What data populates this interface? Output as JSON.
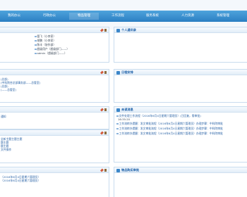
{
  "nav": {
    "items": [
      {
        "label": "我的办公"
      },
      {
        "label": "行政办公"
      },
      {
        "label": "物品管理"
      },
      {
        "label": "工作流程"
      },
      {
        "label": "服务系统"
      },
      {
        "label": "人力资源"
      },
      {
        "label": "系统管理"
      }
    ]
  },
  "left_panels": [
    {
      "title": "",
      "rows": [
        "管飞（小李家）",
        "胡鹏（小李家）",
        "陈丰（协作部）",
        "超级用户（超级部门——）",
        "admin（超级部门——）"
      ]
    },
    {
      "title": "",
      "rows": [
        "(总部)",
        "(中科院合总部事务部——总管室)",
        "(总部)",
        "(——总管室)"
      ]
    },
    {
      "title": "",
      "rows": [
        "通知"
      ]
    },
    {
      "title": "",
      "rows": [
        "全新主题主题主题",
        "题主题",
        "题主题",
        "文件操作"
      ]
    },
    {
      "title": "",
      "rows": [
        "（2016年6月4日星期六管理员）",
        "（2016年6月4日星期六管理员）"
      ]
    }
  ],
  "right_panels": {
    "address_book": {
      "title": "个人通讯录"
    },
    "calendar": {
      "title": "日程安排"
    },
    "todo": {
      "title": "未读消息",
      "rows": [
        "文件处理工作流程（2016年6月4日星期六管理员）(已回复，需审批)",
        "16:35:20",
        "工作流转办提醒：发文审批流程（2016年6月4日星期六管理员）办理步骤：中科院审批",
        "工作流转办提醒：发文审批流程（2016年6月4日星期六管理员）办理步骤：中科院审批",
        "工作流转办提醒：发文审批流程（2016年6月4日星期六管理员）办理步骤：中科院审批"
      ]
    },
    "items": {
      "title": "物品购买审批"
    }
  }
}
